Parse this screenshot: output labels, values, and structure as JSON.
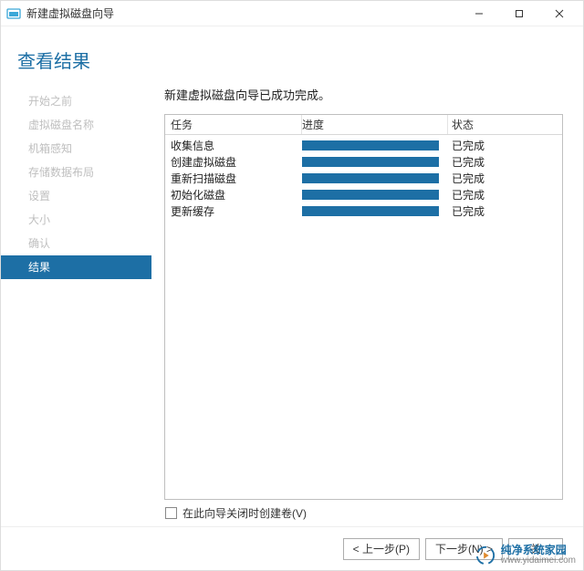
{
  "window": {
    "title": "新建虚拟磁盘向导"
  },
  "page": {
    "heading": "查看结果",
    "success_message": "新建虚拟磁盘向导已成功完成。"
  },
  "sidebar": {
    "items": [
      {
        "label": "开始之前"
      },
      {
        "label": "虚拟磁盘名称"
      },
      {
        "label": "机箱感知"
      },
      {
        "label": "存储数据布局"
      },
      {
        "label": "设置"
      },
      {
        "label": "大小"
      },
      {
        "label": "确认"
      },
      {
        "label": "结果"
      }
    ],
    "active_index": 7
  },
  "results": {
    "columns": {
      "task": "任务",
      "progress": "进度",
      "status": "状态"
    },
    "rows": [
      {
        "task": "收集信息",
        "status": "已完成"
      },
      {
        "task": "创建虚拟磁盘",
        "status": "已完成"
      },
      {
        "task": "重新扫描磁盘",
        "status": "已完成"
      },
      {
        "task": "初始化磁盘",
        "status": "已完成"
      },
      {
        "task": "更新缓存",
        "status": "已完成"
      }
    ]
  },
  "volume_checkbox": {
    "label": "在此向导关闭时创建卷(V)",
    "checked": false
  },
  "buttons": {
    "prev": "< 上一步(P)",
    "next": "下一步(N) >",
    "close_partial": "关"
  },
  "watermark": {
    "line1": "纯净系统家园",
    "line2": "www.yidaimei.com"
  },
  "colors": {
    "accent": "#1d6fa5"
  }
}
